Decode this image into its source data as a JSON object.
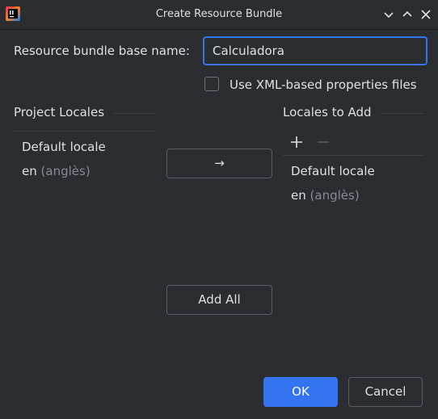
{
  "window": {
    "title": "Create Resource Bundle",
    "app_icon": "intellij-idea-icon",
    "controls": [
      "chevron-down-icon",
      "chevron-up-icon",
      "close-icon"
    ]
  },
  "form": {
    "base_name_label": "Resource bundle base name:",
    "base_name_value": "Calculadora",
    "xml_checkbox_label": "Use XML-based properties files",
    "xml_checkbox_checked": false
  },
  "project_locales": {
    "title": "Project Locales",
    "items": [
      {
        "label": "Default locale",
        "sub": ""
      },
      {
        "label": "en",
        "sub": "(anglès)"
      }
    ]
  },
  "locales_to_add": {
    "title": "Locales to Add",
    "add_icon": "plus-icon",
    "remove_icon": "minus-icon",
    "items": [
      {
        "label": "Default locale",
        "sub": ""
      },
      {
        "label": "en",
        "sub": "(anglès)"
      }
    ]
  },
  "buttons": {
    "move_right_icon": "arrow-right-icon",
    "move_right_glyph": "→",
    "add_all": "Add All",
    "ok": "OK",
    "cancel": "Cancel"
  },
  "colors": {
    "background": "#2b2d30",
    "accent": "#3574f0",
    "text": "#dfe1e5",
    "secondary_text": "#868a91"
  }
}
